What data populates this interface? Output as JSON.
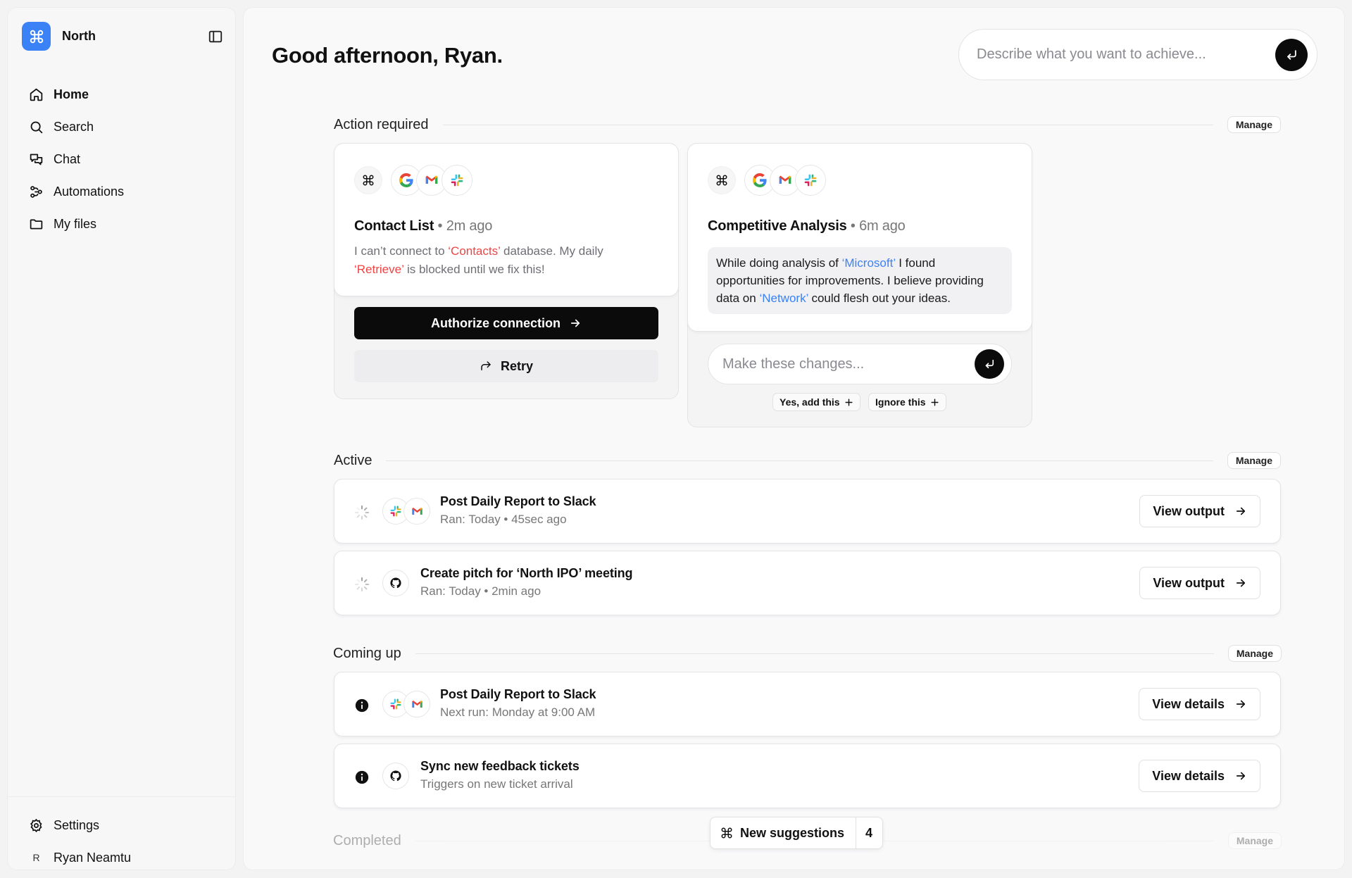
{
  "app": {
    "name": "North",
    "brand_color": "#3b82f6"
  },
  "sidebar": {
    "items": [
      {
        "label": "Home",
        "icon": "home-icon",
        "active": true
      },
      {
        "label": "Search",
        "icon": "search-icon"
      },
      {
        "label": "Chat",
        "icon": "chat-icon"
      },
      {
        "label": "Automations",
        "icon": "automations-icon"
      },
      {
        "label": "My files",
        "icon": "folder-icon"
      }
    ],
    "settings_label": "Settings",
    "user": {
      "initial": "R",
      "name": "Ryan Neamtu"
    }
  },
  "header": {
    "greeting": "Good afternoon, Ryan.",
    "prompt_placeholder": "Describe what you want to achieve..."
  },
  "sections": {
    "action_required": {
      "title": "Action required",
      "manage": "Manage"
    },
    "active": {
      "title": "Active",
      "manage": "Manage"
    },
    "coming_up": {
      "title": "Coming up",
      "manage": "Manage"
    },
    "completed": {
      "title": "Completed",
      "manage": "Manage"
    }
  },
  "action_cards": {
    "contact_list": {
      "title": "Contact List",
      "time": "2m ago",
      "desc_1": "I can’t connect to ",
      "desc_highlight_1": "‘Contacts’",
      "desc_2": " database. My daily ",
      "desc_highlight_2": "‘Retrieve’",
      "desc_3": " is blocked until we fix this!",
      "authorize_label": "Authorize connection",
      "retry_label": "Retry"
    },
    "competitive": {
      "title": "Competitive Analysis",
      "time": "6m ago",
      "msg_1": "While doing analysis of ",
      "msg_highlight_1": "‘Microsoft’",
      "msg_2": " I found opportunities for improvements. I believe providing data on ",
      "msg_highlight_2": "‘Network’",
      "msg_3": " could flesh out your ideas.",
      "reply_placeholder": "Make these changes...",
      "yes_label": "Yes, add this",
      "ignore_label": "Ignore this"
    }
  },
  "active_rows": [
    {
      "title": "Post Daily Report to Slack",
      "sub": "Ran: Today • 45sec ago",
      "button": "View output",
      "icons": [
        "slack-icon",
        "gmail-icon"
      ]
    },
    {
      "title": "Create pitch for ‘North IPO’ meeting",
      "sub": "Ran: Today • 2min ago",
      "button": "View output",
      "icons": [
        "github-icon"
      ]
    }
  ],
  "coming_rows": [
    {
      "title": "Post Daily Report to Slack",
      "sub": "Next run: Monday at 9:00 AM",
      "button": "View details",
      "icons": [
        "slack-icon",
        "gmail-icon"
      ]
    },
    {
      "title": "Sync new feedback tickets",
      "sub": "Triggers on new ticket arrival",
      "button": "View details",
      "icons": [
        "github-icon"
      ]
    }
  ],
  "suggestions": {
    "label": "New suggestions",
    "count": "4"
  }
}
